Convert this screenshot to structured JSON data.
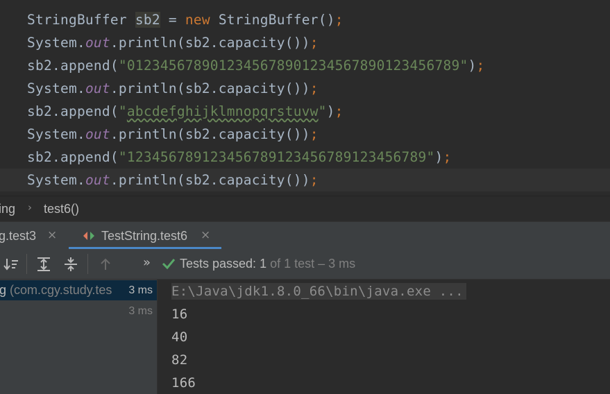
{
  "editor": {
    "lines": [
      [
        {
          "t": "StringBuffer ",
          "c": "plain"
        },
        {
          "t": "sb2",
          "c": "hl"
        },
        {
          "t": " = ",
          "c": "plain"
        },
        {
          "t": "new",
          "c": "kw"
        },
        {
          "t": " StringBuffer()",
          "c": "plain"
        },
        {
          "t": ";",
          "c": "semi"
        }
      ],
      [
        {
          "t": "System.",
          "c": "plain"
        },
        {
          "t": "out",
          "c": "field"
        },
        {
          "t": ".println(sb2.capacity())",
          "c": "plain"
        },
        {
          "t": ";",
          "c": "semi"
        }
      ],
      [
        {
          "t": "sb2.append(",
          "c": "plain"
        },
        {
          "t": "\"0123456789012345678901234567890123456789\"",
          "c": "str"
        },
        {
          "t": ")",
          "c": "plain"
        },
        {
          "t": ";",
          "c": "semi"
        }
      ],
      [
        {
          "t": "System.",
          "c": "plain"
        },
        {
          "t": "out",
          "c": "field"
        },
        {
          "t": ".println(sb2.capacity())",
          "c": "plain"
        },
        {
          "t": ";",
          "c": "semi"
        }
      ],
      [
        {
          "t": "sb2.append(",
          "c": "plain"
        },
        {
          "t": "\"",
          "c": "str"
        },
        {
          "t": "abcdefghijklmnopqrstuvw",
          "c": "typo"
        },
        {
          "t": "\"",
          "c": "str"
        },
        {
          "t": ")",
          "c": "plain"
        },
        {
          "t": ";",
          "c": "semi"
        }
      ],
      [
        {
          "t": "System.",
          "c": "plain"
        },
        {
          "t": "out",
          "c": "field"
        },
        {
          "t": ".println(sb2.capacity())",
          "c": "plain"
        },
        {
          "t": ";",
          "c": "semi"
        }
      ],
      [
        {
          "t": "sb2.append(",
          "c": "plain"
        },
        {
          "t": "\"123456789123456789123456789123456789\"",
          "c": "str"
        },
        {
          "t": ")",
          "c": "plain"
        },
        {
          "t": ";",
          "c": "semi"
        }
      ],
      [
        {
          "t": "System.",
          "c": "plain"
        },
        {
          "t": "out",
          "c": "field"
        },
        {
          "t": ".println(sb2.capacity())",
          "c": "plain"
        },
        {
          "t": ";",
          "c": "semi"
        }
      ]
    ]
  },
  "breadcrumb": {
    "class_partial": "ing",
    "method": "test6()"
  },
  "tabs": {
    "first_label": "g.test3",
    "active_label": "TestString.test6",
    "close_glyph": "×"
  },
  "toolbar": {
    "chevron": "»",
    "status_prefix": "Tests passed: ",
    "status_count": "1",
    "status_suffix": " of 1 test – 3 ms"
  },
  "test_tree": {
    "root_name": "g",
    "root_package": " (com.cgy.study.tes",
    "root_time": "3 ms",
    "child_time": "3 ms"
  },
  "console": {
    "command": "E:\\Java\\jdk1.8.0_66\\bin\\java.exe ...",
    "outputs": [
      "16",
      "40",
      "82",
      "166"
    ]
  },
  "colors": {
    "accent": "#4a88c7",
    "success": "#59a869",
    "diamond_left": "#e07a5f",
    "diamond_right": "#59a869"
  }
}
